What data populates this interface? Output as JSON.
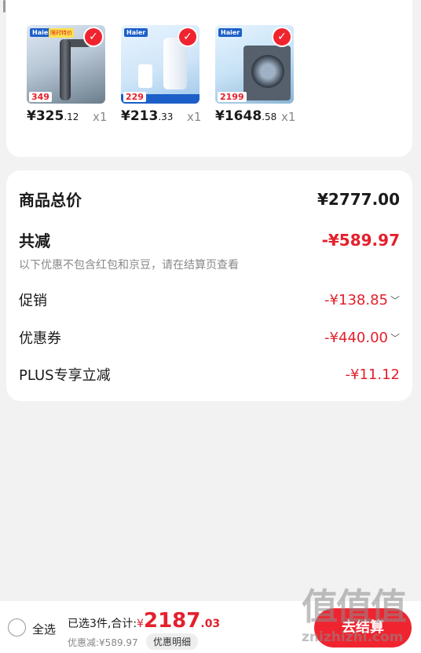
{
  "products": [
    {
      "brand": "Haier",
      "promo": "限时特价",
      "badge_price": "349",
      "price_int": "¥325",
      "price_dec": ".12",
      "qty": "x1"
    },
    {
      "brand": "Haier",
      "promo": "",
      "badge_price": "229",
      "price_int": "¥213",
      "price_dec": ".33",
      "qty": "x1"
    },
    {
      "brand": "Haier",
      "promo": "",
      "badge_price": "2199",
      "price_int": "¥1648",
      "price_dec": ".58",
      "qty": "x1"
    }
  ],
  "summary": {
    "total_label": "商品总价",
    "total_value": "¥2777.00",
    "reduce_label": "共减",
    "reduce_value": "-¥589.97",
    "note": "以下优惠不包含红包和京豆，请在结算页查看",
    "promo_label": "促销",
    "promo_value": "-¥138.85",
    "coupon_label": "优惠券",
    "coupon_value": "-¥440.00",
    "plus_label": "PLUS专享立减",
    "plus_value": "-¥11.12",
    "chevron": "﹀"
  },
  "bottom_bar": {
    "select_all": "全选",
    "selected_text": "已选3件,合计:",
    "currency": "¥",
    "total_int": "2187",
    "total_dec": ".03",
    "discount_text": "优惠减:¥589.97",
    "detail_button": "优惠明细",
    "checkout_button": "去结算"
  },
  "watermark": {
    "logo": "值值值",
    "site": "znizhizhi.com"
  },
  "colors": {
    "accent": "#f0242f",
    "price_red": "#e4202c"
  }
}
